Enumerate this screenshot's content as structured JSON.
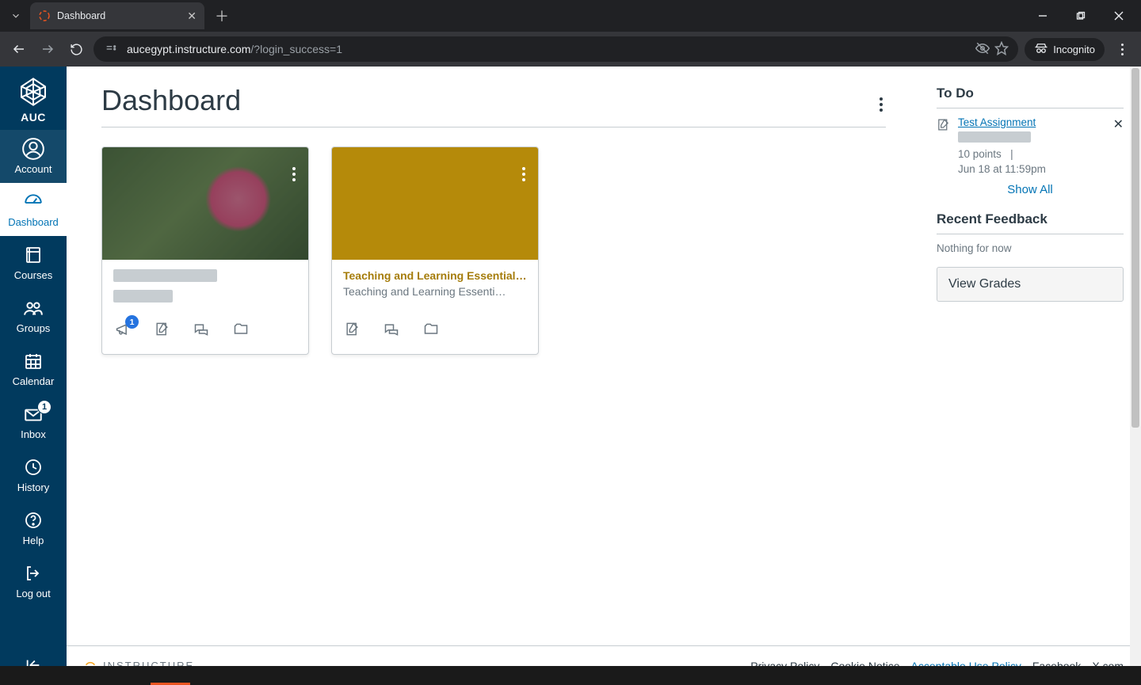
{
  "browser": {
    "tab_title": "Dashboard",
    "url_display_host": "aucegypt.instructure.com",
    "url_display_path": "/?login_success=1",
    "incognito_label": "Incognito"
  },
  "global_nav": {
    "logo_text": "AUC",
    "items": [
      {
        "id": "account",
        "label": "Account"
      },
      {
        "id": "dashboard",
        "label": "Dashboard"
      },
      {
        "id": "courses",
        "label": "Courses"
      },
      {
        "id": "groups",
        "label": "Groups"
      },
      {
        "id": "calendar",
        "label": "Calendar"
      },
      {
        "id": "inbox",
        "label": "Inbox",
        "badge": "1"
      },
      {
        "id": "history",
        "label": "History"
      },
      {
        "id": "help",
        "label": "Help"
      },
      {
        "id": "logout",
        "label": "Log out"
      }
    ]
  },
  "header": {
    "title": "Dashboard"
  },
  "courses": [
    {
      "id": "course1",
      "title_redacted": true,
      "sub_redacted": true,
      "accent": "#7a9f52",
      "actions": {
        "announcements_badge": "1"
      },
      "show_announcements": true
    },
    {
      "id": "course2",
      "title": "Teaching and Learning Essentials f…",
      "subtitle": "Teaching and Learning Essenti…",
      "accent": "#b58a0a",
      "show_announcements": false
    }
  ],
  "sidebar": {
    "todo_heading": "To Do",
    "todo_items": [
      {
        "link": "Test Assignment",
        "points": "10 points",
        "sep": "|",
        "due": "Jun 18 at 11:59pm"
      }
    ],
    "show_all": "Show All",
    "feedback_heading": "Recent Feedback",
    "feedback_empty": "Nothing for now",
    "view_grades": "View Grades"
  },
  "footer": {
    "brand": "INSTRUCTURE",
    "links": [
      {
        "label": "Privacy Policy"
      },
      {
        "label": "Cookie Notice"
      },
      {
        "label": "Acceptable Use Policy",
        "underline": true
      },
      {
        "label": "Facebook"
      },
      {
        "label": "X.com"
      }
    ]
  }
}
